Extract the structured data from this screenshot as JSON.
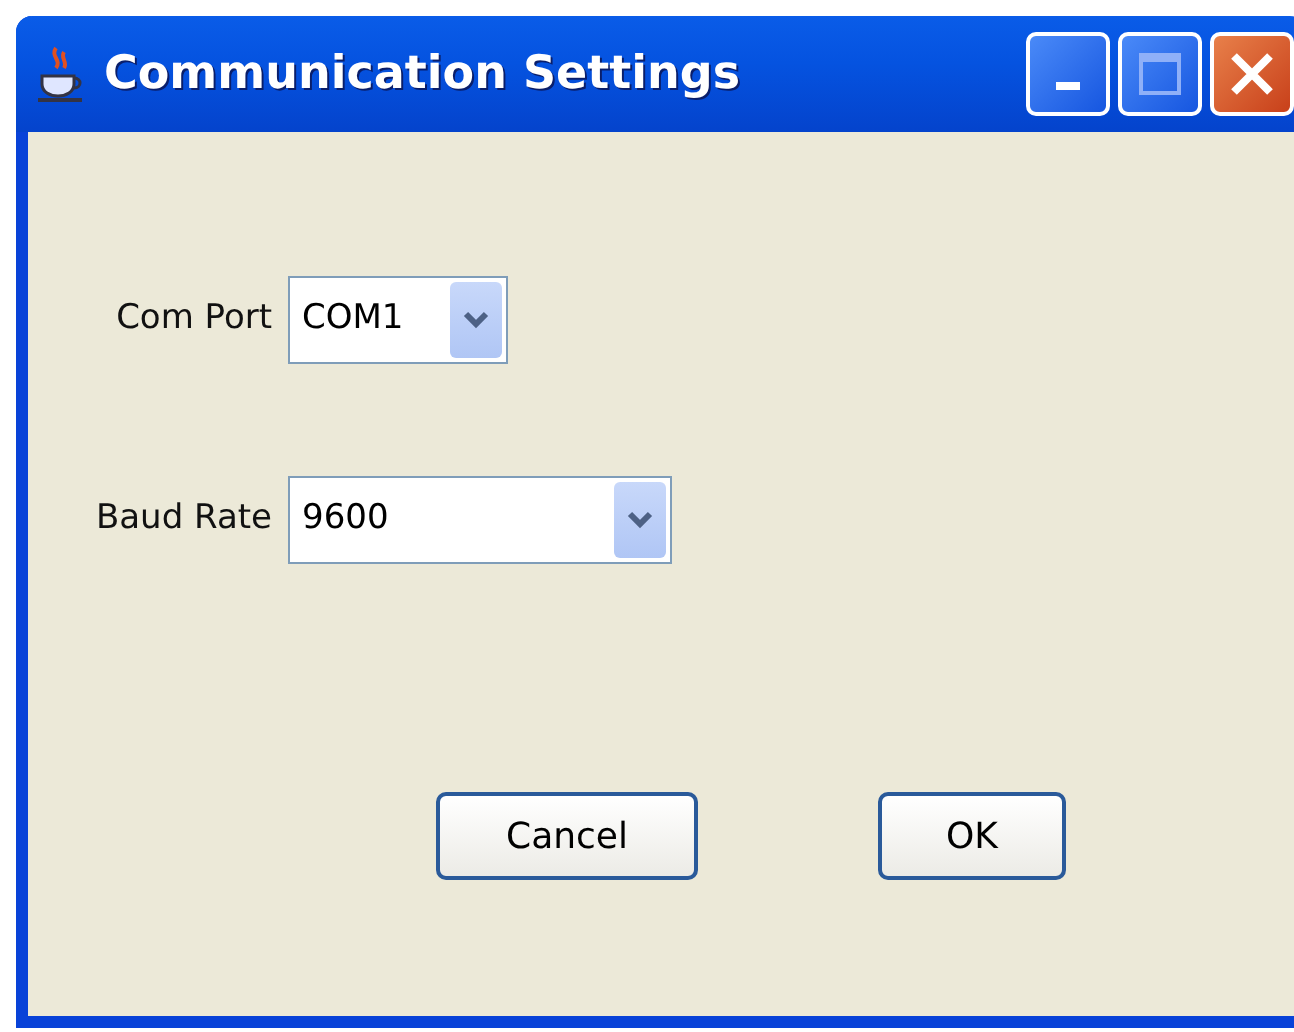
{
  "window": {
    "title": "Communication Settings"
  },
  "fields": [
    {
      "label": "Com Port",
      "value": "COM1"
    },
    {
      "label": "Baud Rate",
      "value": "9600"
    }
  ],
  "buttons": [
    "Cancel",
    "OK"
  ]
}
